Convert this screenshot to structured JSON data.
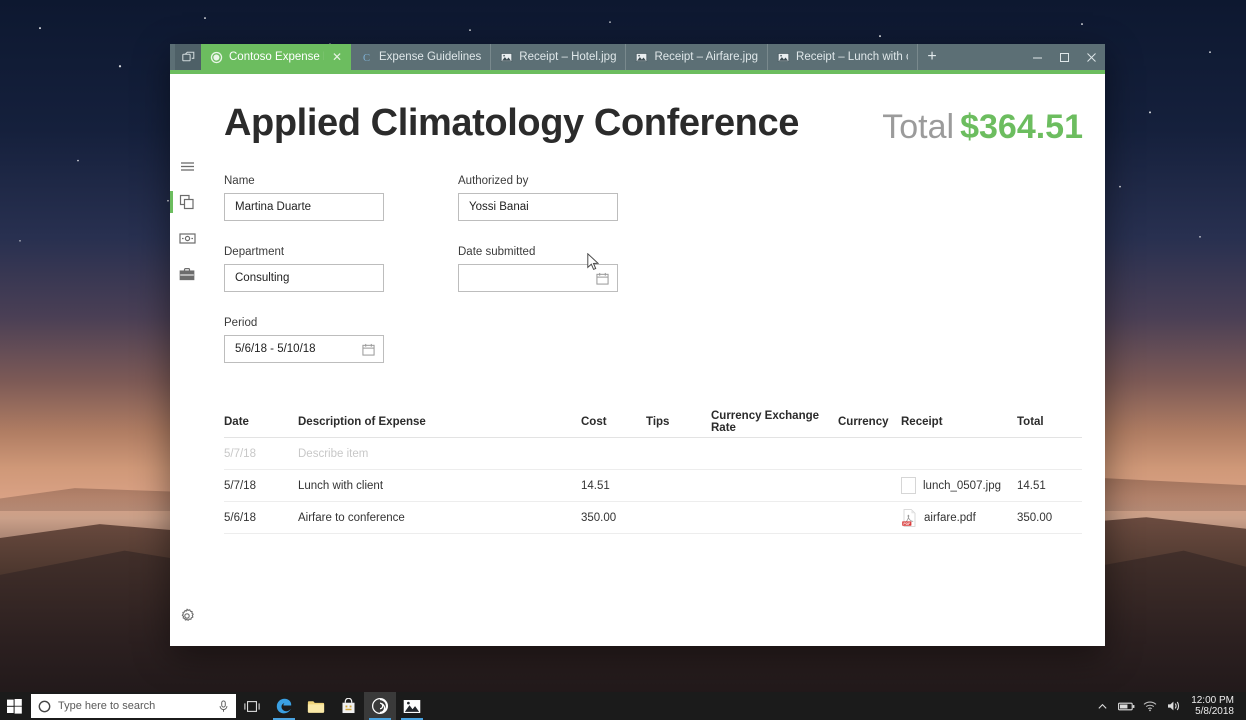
{
  "browser": {
    "window_logo_icon": "browser-logo-icon",
    "tabs": [
      {
        "title": "Contoso Expense Rep",
        "favicon": "contoso-icon",
        "active": true,
        "closable": true
      },
      {
        "title": "Expense Guidelines",
        "favicon": "c-document-icon",
        "active": false,
        "closable": false
      },
      {
        "title": "Receipt – Hotel.jpg",
        "favicon": "image-icon",
        "active": false,
        "closable": false
      },
      {
        "title": "Receipt – Airfare.jpg",
        "favicon": "image-icon",
        "active": false,
        "closable": false
      },
      {
        "title": "Receipt – Lunch with clie",
        "favicon": "image-icon",
        "active": false,
        "closable": false
      }
    ],
    "new_tab_label": "+",
    "controls": {
      "minimize": "—",
      "maximize": "▢",
      "close": "✕"
    },
    "accent_color": "#6cbd5f",
    "tabstrip_color": "#5c6f75"
  },
  "sidebar": {
    "items": [
      {
        "icon": "hamburger-menu-icon",
        "name": "menu",
        "active": false
      },
      {
        "icon": "expense-reports-icon",
        "name": "expense-reports",
        "active": true
      },
      {
        "icon": "banknote-icon",
        "name": "payments",
        "active": false
      },
      {
        "icon": "briefcase-icon",
        "name": "business",
        "active": false
      }
    ],
    "settings": {
      "icon": "gear-icon",
      "name": "settings"
    }
  },
  "page": {
    "title": "Applied Climatology Conference",
    "total_label": "Total",
    "total_value": "$364.51",
    "total_color": "#6cbd5f"
  },
  "form": {
    "fields": [
      {
        "label": "Name",
        "value": "Martina Duarte",
        "placeholder": "",
        "calendar": false
      },
      {
        "label": "Authorized by",
        "value": "Yossi Banai",
        "placeholder": "",
        "calendar": false
      },
      {
        "label": "Department",
        "value": "Consulting",
        "placeholder": "",
        "calendar": false
      },
      {
        "label": "Date submitted",
        "value": "",
        "placeholder": "",
        "calendar": true
      },
      {
        "label": "Period",
        "value": "5/6/18 - 5/10/18",
        "placeholder": "",
        "calendar": true
      }
    ]
  },
  "table": {
    "columns": [
      "Date",
      "Description of Expense",
      "Cost",
      "Tips",
      "Currency Exchange Rate",
      "Currency",
      "Receipt",
      "Total"
    ],
    "placeholder_row": {
      "date": "5/7/18",
      "description": "Describe item",
      "cost": "",
      "tips": "",
      "rate": "",
      "currency": "",
      "receipt": "",
      "total": ""
    },
    "rows": [
      {
        "date": "5/7/18",
        "description": "Lunch with client",
        "cost": "14.51",
        "tips": "",
        "rate": "",
        "currency": "",
        "receipt_name": "lunch_0507.jpg",
        "receipt_icon": "image-thumbnail-icon",
        "total": "14.51"
      },
      {
        "date": "5/6/18",
        "description": "Airfare to conference",
        "cost": "350.00",
        "tips": "",
        "rate": "",
        "currency": "",
        "receipt_name": "airfare.pdf",
        "receipt_icon": "pdf-file-icon",
        "total": "350.00"
      }
    ]
  },
  "taskbar": {
    "start_icon": "windows-start-icon",
    "search_placeholder": "Type here to search",
    "search_icon": "cortana-circle-icon",
    "mic_icon": "microphone-icon",
    "apps": [
      {
        "name": "task-view",
        "icon": "task-view-icon",
        "running": false,
        "active": false
      },
      {
        "name": "microsoft-edge",
        "icon": "edge-icon",
        "running": true,
        "active": false
      },
      {
        "name": "file-explorer",
        "icon": "folder-icon",
        "running": false,
        "active": false
      },
      {
        "name": "microsoft-store",
        "icon": "store-bag-icon",
        "running": false,
        "active": false
      },
      {
        "name": "contoso-browser",
        "icon": "spiral-browser-icon",
        "running": true,
        "active": true
      },
      {
        "name": "photos",
        "icon": "photos-icon",
        "running": true,
        "active": false
      }
    ],
    "tray": [
      {
        "name": "show-hidden-icons",
        "icon": "chevron-up-icon"
      },
      {
        "name": "battery",
        "icon": "battery-icon"
      },
      {
        "name": "network",
        "icon": "wifi-icon"
      },
      {
        "name": "volume",
        "icon": "speaker-icon"
      }
    ],
    "clock_time": "12:00 PM",
    "clock_date": "5/8/2018"
  }
}
